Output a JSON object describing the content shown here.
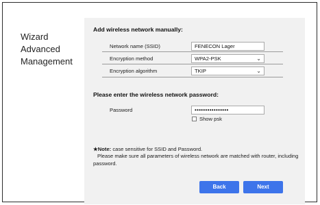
{
  "sidebar": {
    "items": [
      {
        "label": "Wizard"
      },
      {
        "label": "Advanced"
      },
      {
        "label": "Management"
      }
    ]
  },
  "manual": {
    "title": "Add wireless network manually:",
    "ssid_label": "Network name (SSID)",
    "ssid_value": "FENECON Lager",
    "enc_method_label": "Encryption method",
    "enc_method_value": "WPA2-PSK",
    "enc_algo_label": "Encryption algorithm",
    "enc_algo_value": "TKIP"
  },
  "password": {
    "title": "Please enter the wireless network password:",
    "label": "Password",
    "value": "••••••••••••••••",
    "show_label": "Show psk"
  },
  "note": {
    "head": "★Note:",
    "line1": " case sensitive for SSID and Password.",
    "line2": "Please make sure all parameters of wireless network are matched with router,  including password."
  },
  "buttons": {
    "back": "Back",
    "next": "Next"
  },
  "colors": {
    "button": "#3d74ea",
    "panel": "#f1f1f1"
  },
  "icons": {
    "select_chevron": "chevron-down-icon"
  }
}
